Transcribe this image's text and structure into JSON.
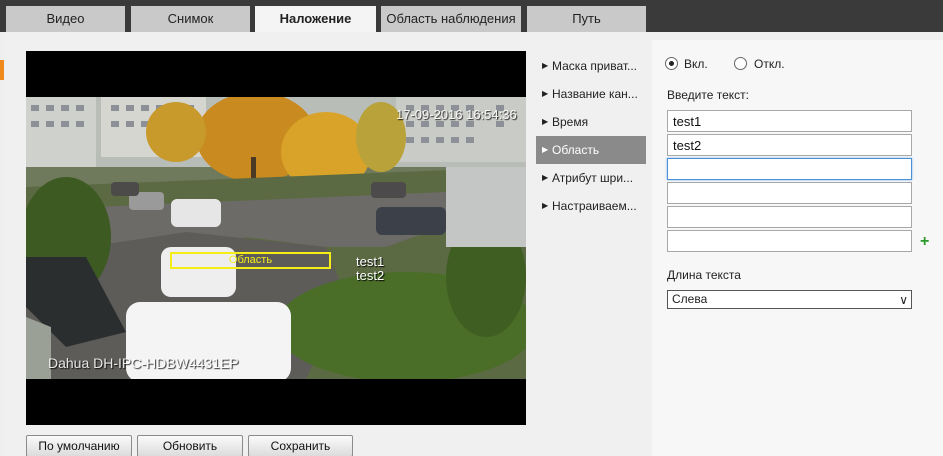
{
  "tabs": [
    {
      "label": "Видео"
    },
    {
      "label": "Снимок"
    },
    {
      "label": "Наложение"
    },
    {
      "label": "Область наблюдения"
    },
    {
      "label": "Путь"
    }
  ],
  "video": {
    "timestamp": "17-09-2016 16:54:36",
    "channel_title": "Dahua DH-IPC-HDBW4431EP",
    "region_label": "Область",
    "overlay_lines": [
      "test1",
      "test2"
    ]
  },
  "buttons": {
    "default": "По умолчанию",
    "refresh": "Обновить",
    "save": "Сохранить"
  },
  "menu": [
    {
      "label": "Маска приват..."
    },
    {
      "label": "Название кан..."
    },
    {
      "label": "Время"
    },
    {
      "label": "Область"
    },
    {
      "label": "Атрибут шри..."
    },
    {
      "label": "Настраиваем..."
    }
  ],
  "menu_active_index": 3,
  "settings": {
    "on_label": "Вкл.",
    "off_label": "Откл.",
    "enabled": true,
    "text_prompt": "Введите текст:",
    "text_lines": [
      "test1",
      "test2",
      "",
      "",
      "",
      ""
    ],
    "length_label": "Длина текста",
    "alignment_value": "Слева"
  },
  "icons": {
    "arrow": "triangle-right-icon",
    "add": "plus-icon",
    "dropdown": "chevron-down-icon"
  },
  "colors": {
    "accent_orange": "#f08a1c",
    "region_box": "#f5ee16",
    "add_green": "#2a9a2a",
    "menu_active": "#8a8a8a"
  }
}
